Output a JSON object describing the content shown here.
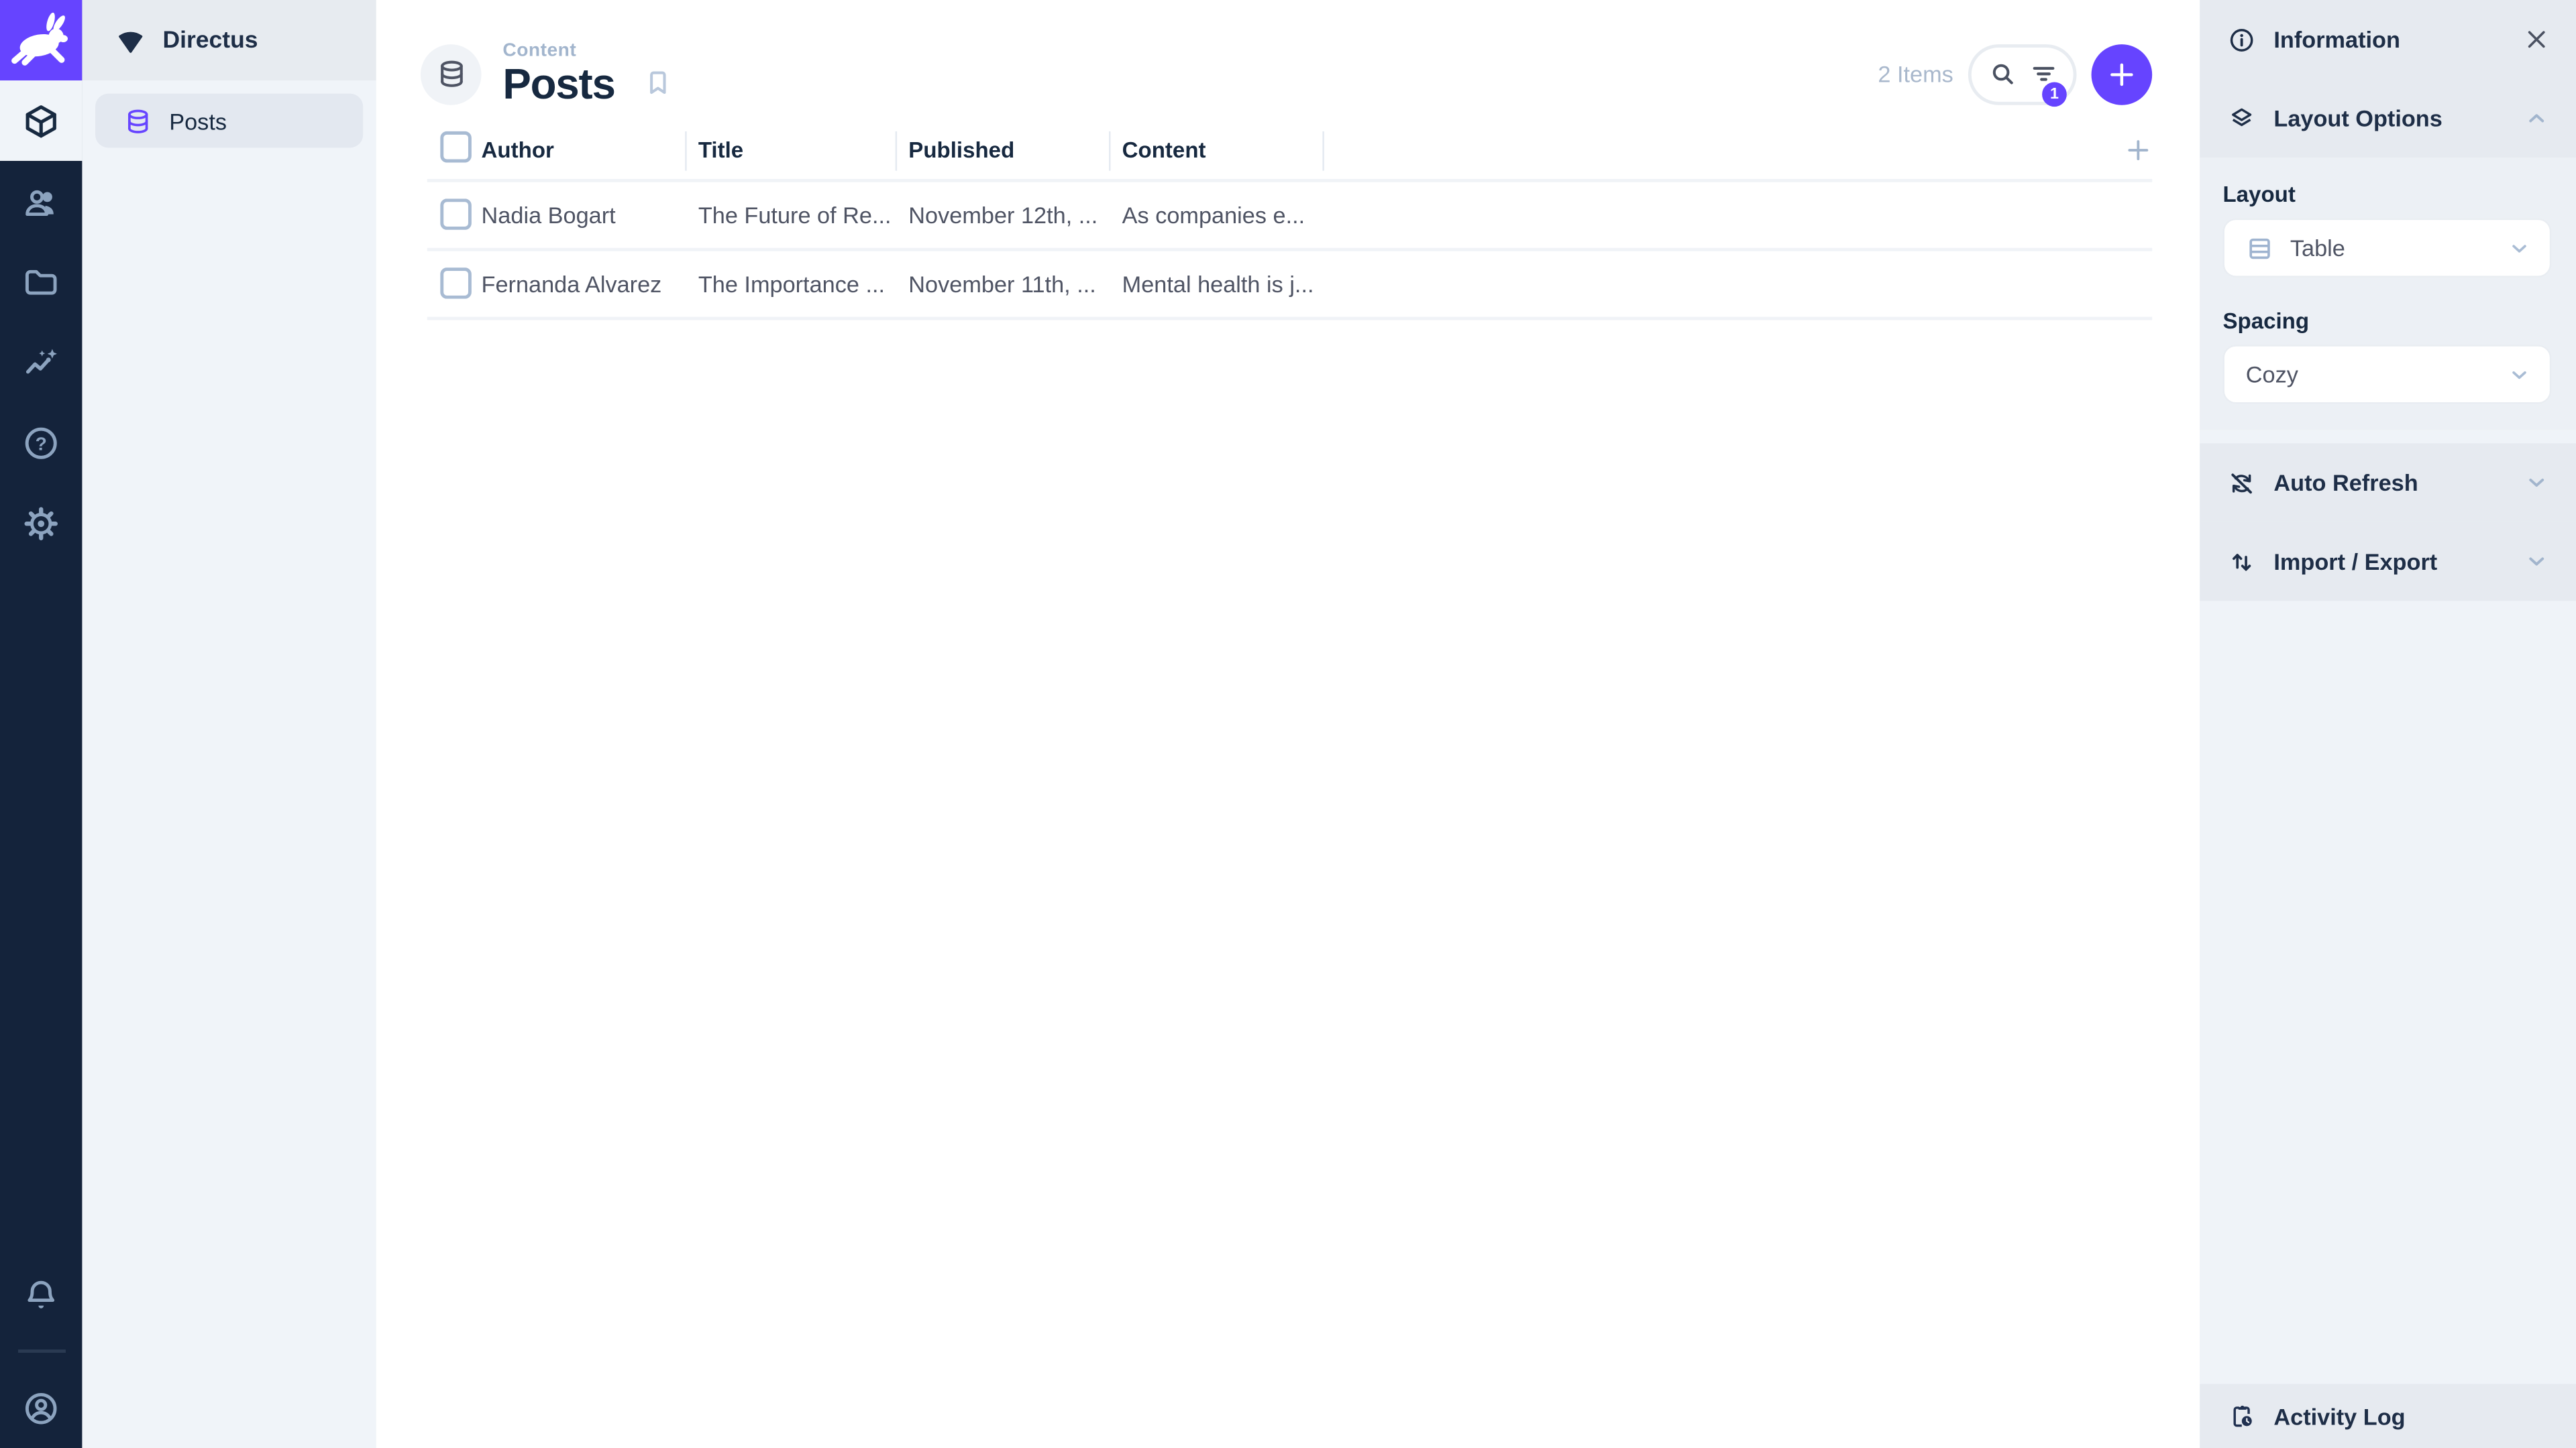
{
  "brand": {
    "name": "Directus"
  },
  "nav": {
    "project_name": "Directus",
    "item_posts": "Posts"
  },
  "header": {
    "breadcrumb": "Content",
    "title": "Posts",
    "items_count": "2 Items",
    "filter_badge": "1"
  },
  "table": {
    "columns": [
      "Author",
      "Title",
      "Published",
      "Content"
    ],
    "rows": [
      {
        "author": "Nadia Bogart",
        "title": "The Future of Re...",
        "published": "November 12th, ...",
        "content": "As companies e..."
      },
      {
        "author": "Fernanda Alvarez",
        "title": "The Importance ...",
        "published": "November 11th, ...",
        "content": "Mental health is j..."
      }
    ]
  },
  "sidebar": {
    "information_label": "Information",
    "layout_options_label": "Layout Options",
    "layout_label": "Layout",
    "layout_value": "Table",
    "spacing_label": "Spacing",
    "spacing_value": "Cozy",
    "auto_refresh_label": "Auto Refresh",
    "import_export_label": "Import / Export",
    "activity_log_label": "Activity Log"
  },
  "colors": {
    "primary": "#6644FF",
    "module_bar_bg": "#14233B",
    "module_icon": "#8CA3BF",
    "text_dark": "#1E2E47",
    "text_normal": "#4F5464",
    "text_subdued": "#A2B5CD",
    "border": "#E4EAF1"
  }
}
